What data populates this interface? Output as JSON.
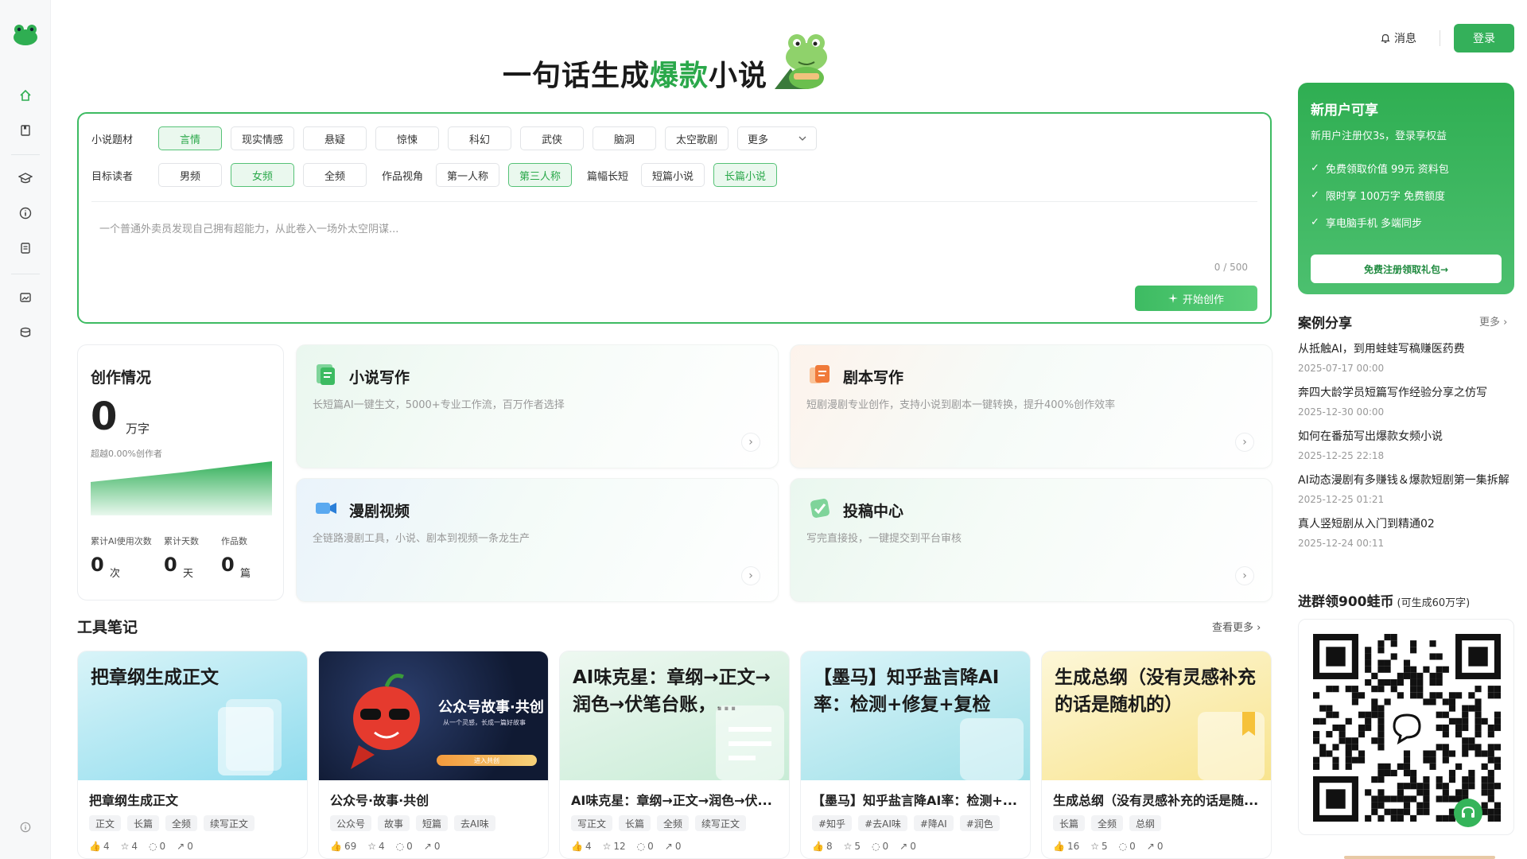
{
  "topbar": {
    "message_label": "消息",
    "login_label": "登录"
  },
  "hero": {
    "title_pre": "一句话生成",
    "title_highlight": "爆款",
    "title_post": "小说"
  },
  "composer": {
    "row1_label": "小说题材",
    "genres": [
      "言情",
      "现实情感",
      "悬疑",
      "惊悚",
      "科幻",
      "武侠",
      "脑洞",
      "太空歌剧"
    ],
    "genre_selected": "言情",
    "more_label": "更多",
    "row2_label": "目标读者",
    "readers": [
      "男频",
      "女频",
      "全频"
    ],
    "reader_selected": "女频",
    "pov_label": "作品视角",
    "povs": [
      "第一人称",
      "第三人称"
    ],
    "pov_selected": "第三人称",
    "length_label": "篇幅长短",
    "lengths": [
      "短篇小说",
      "长篇小说"
    ],
    "length_selected": "长篇小说",
    "placeholder": "一个普通外卖员发现自己拥有超能力，从此卷入一场外太空阴谋...",
    "counter": "0 / 500",
    "start_label": "开始创作"
  },
  "stats": {
    "title": "创作情况",
    "big_number": "0",
    "big_unit": "万字",
    "beat": "超越0.00%创作者",
    "items": [
      {
        "label": "累计AI使用次数",
        "value": "0",
        "unit": "次"
      },
      {
        "label": "累计天数",
        "value": "0",
        "unit": "天"
      },
      {
        "label": "作品数",
        "value": "0",
        "unit": "篇"
      }
    ]
  },
  "features": [
    {
      "title": "小说写作",
      "desc": "长短篇AI一键生文，5000+专业工作流，百万作者选择"
    },
    {
      "title": "剧本写作",
      "desc": "短剧漫剧专业创作，支持小说到剧本一键转换，提升400%创作效率"
    },
    {
      "title": "漫剧视频",
      "desc": "全链路漫剧工具，小说、剧本到视频一条龙生产"
    },
    {
      "title": "投稿中心",
      "desc": "写完直接投，一键提交到平台审核"
    }
  ],
  "notes_section": {
    "title": "工具笔记",
    "more": "查看更多"
  },
  "notes": [
    {
      "cover_text": "把章纲生成正文",
      "title": "把章纲生成正文",
      "tags": [
        "正文",
        "长篇",
        "全频",
        "续写正文"
      ],
      "likes": "4",
      "stars": "4",
      "comments": "0",
      "shares": "0"
    },
    {
      "cover_text": "公众号故事·共创",
      "cover_sub": "从一个灵感，长成一篇好故事",
      "cover_btn": "进入共创",
      "title": "公众号·故事·共创",
      "tags": [
        "公众号",
        "故事",
        "短篇",
        "去AI味"
      ],
      "likes": "69",
      "stars": "4",
      "comments": "0",
      "shares": "0"
    },
    {
      "cover_text": "AI味克星：章纲→正文→润色→伏笔台账，...",
      "title": "AI味克星：章纲→正文→润色→伏...",
      "tags": [
        "写正文",
        "长篇",
        "全频",
        "续写正文"
      ],
      "likes": "4",
      "stars": "12",
      "comments": "0",
      "shares": "0"
    },
    {
      "cover_text": "【墨马】知乎盐言降AI率：检测+修复+复检",
      "title": "【墨马】知乎盐言降AI率：检测+...",
      "tags": [
        "#知乎",
        "#去AI味",
        "#降AI",
        "#润色"
      ],
      "likes": "8",
      "stars": "5",
      "comments": "0",
      "shares": "0"
    },
    {
      "cover_text": "生成总纲（没有灵感补充的话是随机的）",
      "title": "生成总纲（没有灵感补充的话是随...",
      "tags": [
        "长篇",
        "全频",
        "总纲"
      ],
      "likes": "16",
      "stars": "5",
      "comments": "0",
      "shares": "0"
    }
  ],
  "promo": {
    "title": "新用户可享",
    "sub": "新用户注册仅3s，登录享权益",
    "perks": [
      "免费领取价值 99元 资料包",
      "限时享 100万字 免费额度",
      "享电脑手机 多端同步"
    ],
    "cta": "免费注册领取礼包→"
  },
  "cases": {
    "title": "案例分享",
    "more": "更多",
    "items": [
      {
        "title": "从抵触AI，到用蛙蛙写稿赚医药费",
        "date": "2025-07-17 00:00"
      },
      {
        "title": "奔四大龄学员短篇写作经验分享之仿写",
        "date": "2025-12-30 00:00"
      },
      {
        "title": "如何在番茄写出爆款女频小说",
        "date": "2025-12-25 22:18"
      },
      {
        "title": "AI动态漫剧有多赚钱＆爆款短剧第一集拆解",
        "date": "2025-12-25 01:21"
      },
      {
        "title": "真人竖短剧从入门到精通02",
        "date": "2025-12-24 00:11"
      }
    ]
  },
  "group": {
    "title": "进群领900蛙币",
    "sub": "(可生成60万字)"
  },
  "colors": {
    "accent": "#34b05a",
    "accent_light": "#eaf8ee"
  }
}
